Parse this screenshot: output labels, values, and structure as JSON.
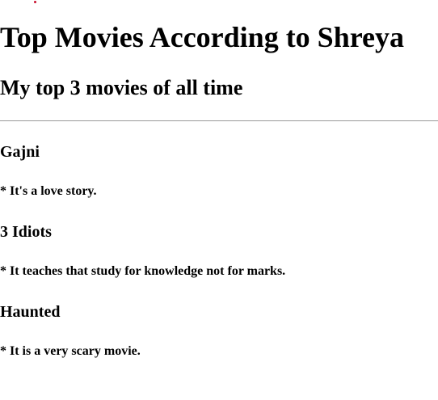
{
  "page": {
    "title": "Top Movies According to Shreya",
    "subtitle": "My top 3 movies of all time"
  },
  "movies": [
    {
      "name": "Gajni",
      "note": "* It's a love story."
    },
    {
      "name": "3 Idiots",
      "note": "* It teaches that study for knowledge not for marks."
    },
    {
      "name": "Haunted",
      "note": "* It is a very scary movie."
    }
  ],
  "colors": {
    "text": "#000000",
    "rule": "#999999",
    "accent_dot": "#c8102e"
  }
}
